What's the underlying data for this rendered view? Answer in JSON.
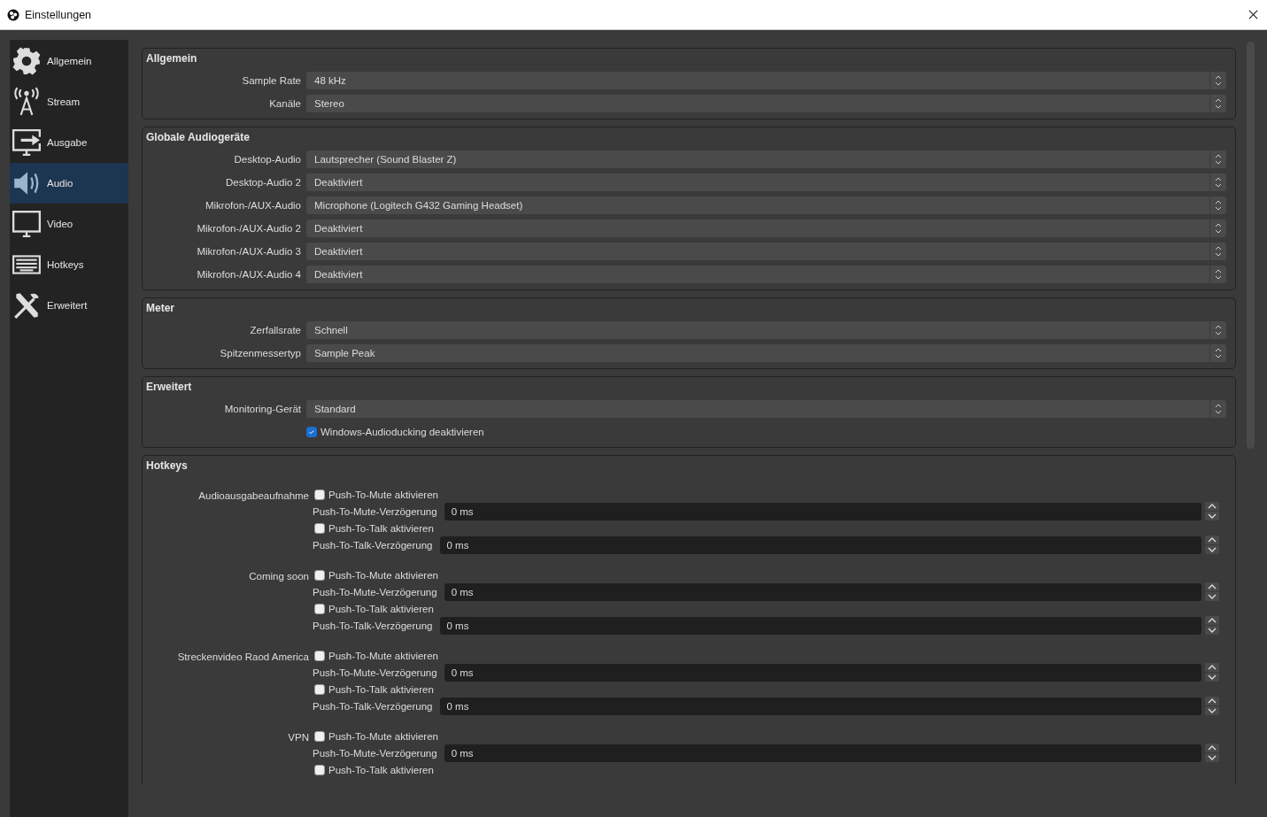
{
  "window": {
    "title": "Einstellungen"
  },
  "sidebar": {
    "items": [
      {
        "label": "Allgemein",
        "selected": false
      },
      {
        "label": "Stream",
        "selected": false
      },
      {
        "label": "Ausgabe",
        "selected": false
      },
      {
        "label": "Audio",
        "selected": true
      },
      {
        "label": "Video",
        "selected": false
      },
      {
        "label": "Hotkeys",
        "selected": false
      },
      {
        "label": "Erweitert",
        "selected": false
      }
    ]
  },
  "groups": [
    {
      "title": "Allgemein",
      "rows": [
        {
          "kind": "select",
          "label": "Sample Rate",
          "value": "48 kHz"
        },
        {
          "kind": "select",
          "label": "Kanäle",
          "value": "Stereo"
        }
      ]
    },
    {
      "title": "Globale Audiogeräte",
      "rows": [
        {
          "kind": "select",
          "label": "Desktop-Audio",
          "value": "Lautsprecher (Sound Blaster Z)"
        },
        {
          "kind": "select",
          "label": "Desktop-Audio 2",
          "value": "Deaktiviert"
        },
        {
          "kind": "select",
          "label": "Mikrofon-/AUX-Audio",
          "value": "Microphone (Logitech G432 Gaming Headset)"
        },
        {
          "kind": "select",
          "label": "Mikrofon-/AUX-Audio 2",
          "value": "Deaktiviert"
        },
        {
          "kind": "select",
          "label": "Mikrofon-/AUX-Audio 3",
          "value": "Deaktiviert"
        },
        {
          "kind": "select",
          "label": "Mikrofon-/AUX-Audio 4",
          "value": "Deaktiviert"
        }
      ]
    },
    {
      "title": "Meter",
      "rows": [
        {
          "kind": "select",
          "label": "Zerfallsrate",
          "value": "Schnell"
        },
        {
          "kind": "select",
          "label": "Spitzenmessertyp",
          "value": "Sample Peak"
        }
      ]
    },
    {
      "title": "Erweitert",
      "rows": [
        {
          "kind": "select",
          "label": "Monitoring-Gerät",
          "value": "Standard"
        },
        {
          "kind": "checkbox",
          "label": "Windows-Audioducking deaktivieren",
          "checked": true
        }
      ]
    }
  ],
  "hotkeys": {
    "title": "Hotkeys",
    "entries": [
      {
        "name": "Audioausgabeaufnahme",
        "rows": [
          {
            "kind": "checkbox",
            "label": "Push-To-Mute aktivieren",
            "checked": false
          },
          {
            "kind": "spin",
            "label": "Push-To-Mute-Verzögerung",
            "value": "0 ms"
          },
          {
            "kind": "checkbox",
            "label": "Push-To-Talk aktivieren",
            "checked": false
          },
          {
            "kind": "spin",
            "label": "Push-To-Talk-Verzögerung",
            "value": "0 ms"
          }
        ]
      },
      {
        "name": "Coming soon",
        "rows": [
          {
            "kind": "checkbox",
            "label": "Push-To-Mute aktivieren",
            "checked": false
          },
          {
            "kind": "spin",
            "label": "Push-To-Mute-Verzögerung",
            "value": "0 ms"
          },
          {
            "kind": "checkbox",
            "label": "Push-To-Talk aktivieren",
            "checked": false
          },
          {
            "kind": "spin",
            "label": "Push-To-Talk-Verzögerung",
            "value": "0 ms"
          }
        ]
      },
      {
        "name": "Streckenvideo Raod America",
        "rows": [
          {
            "kind": "checkbox",
            "label": "Push-To-Mute aktivieren",
            "checked": false
          },
          {
            "kind": "spin",
            "label": "Push-To-Mute-Verzögerung",
            "value": "0 ms"
          },
          {
            "kind": "checkbox",
            "label": "Push-To-Talk aktivieren",
            "checked": false
          },
          {
            "kind": "spin",
            "label": "Push-To-Talk-Verzögerung",
            "value": "0 ms"
          }
        ]
      },
      {
        "name": "VPN",
        "rows": [
          {
            "kind": "checkbox",
            "label": "Push-To-Mute aktivieren",
            "checked": false
          },
          {
            "kind": "spin",
            "label": "Push-To-Mute-Verzögerung",
            "value": "0 ms"
          },
          {
            "kind": "checkbox",
            "label": "Push-To-Talk aktivieren",
            "checked": false
          }
        ]
      }
    ]
  }
}
